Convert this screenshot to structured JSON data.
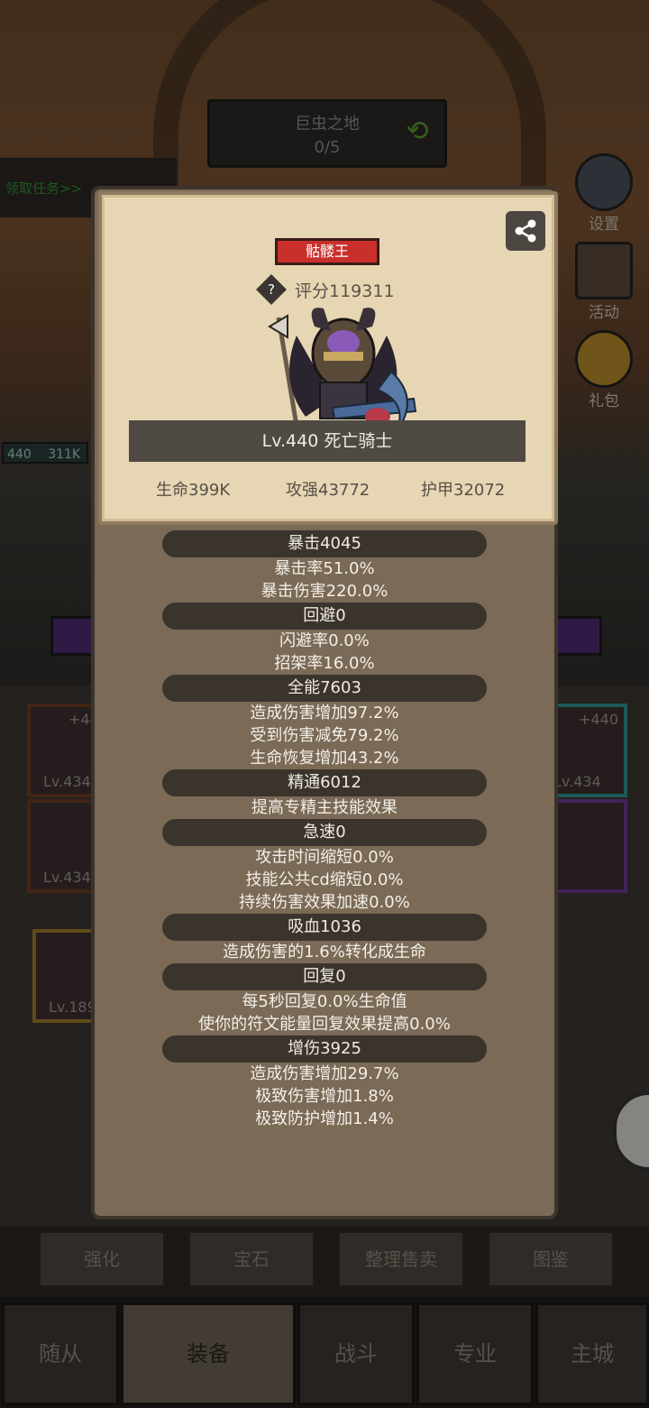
{
  "zone": {
    "name": "巨虫之地",
    "progress": "0/5"
  },
  "quest_banner": "领取任务>>",
  "side_icons": [
    "设置",
    "活动",
    "礼包"
  ],
  "hp_badge": {
    "level": "440",
    "value": "311K"
  },
  "equipment_slots": [
    {
      "level": "Lv.434",
      "plus": "+440"
    },
    {
      "level": "Lv.434",
      "plus": "+440"
    },
    {
      "level": "Lv.434",
      "plus": ""
    },
    {
      "level": "Lv.189",
      "plus": ""
    }
  ],
  "action_tabs": [
    "强化",
    "宝石",
    "整理售卖",
    "图鉴"
  ],
  "navbar": [
    "随从",
    "装备",
    "战斗",
    "专业",
    "主城"
  ],
  "modal": {
    "title_badge": "骷髅王",
    "score": "评分119311",
    "name": "Lv.440 死亡骑士",
    "hp": "生命399K",
    "attack": "攻强43772",
    "armor": "护甲32072",
    "sections": [
      {
        "head": "暴击4045",
        "lines": [
          "暴击率51.0%",
          "暴击伤害220.0%"
        ]
      },
      {
        "head": "回避0",
        "lines": [
          "闪避率0.0%",
          "招架率16.0%"
        ]
      },
      {
        "head": "全能7603",
        "lines": [
          "造成伤害增加97.2%",
          "受到伤害减免79.2%",
          "生命恢复增加43.2%"
        ]
      },
      {
        "head": "精通6012",
        "lines": [
          "提高专精主技能效果"
        ]
      },
      {
        "head": "急速0",
        "lines": [
          "攻击时间缩短0.0%",
          "技能公共cd缩短0.0%",
          "持续伤害效果加速0.0%"
        ]
      },
      {
        "head": "吸血1036",
        "lines": [
          "造成伤害的1.6%转化成生命"
        ]
      },
      {
        "head": "回复0",
        "lines": [
          "每5秒回复0.0%生命值",
          "使你的符文能量回复效果提高0.0%"
        ]
      },
      {
        "head": "增伤3925",
        "lines": [
          "造成伤害增加29.7%",
          "极致伤害增加1.8%",
          "极致防护增加1.4%"
        ]
      }
    ]
  }
}
